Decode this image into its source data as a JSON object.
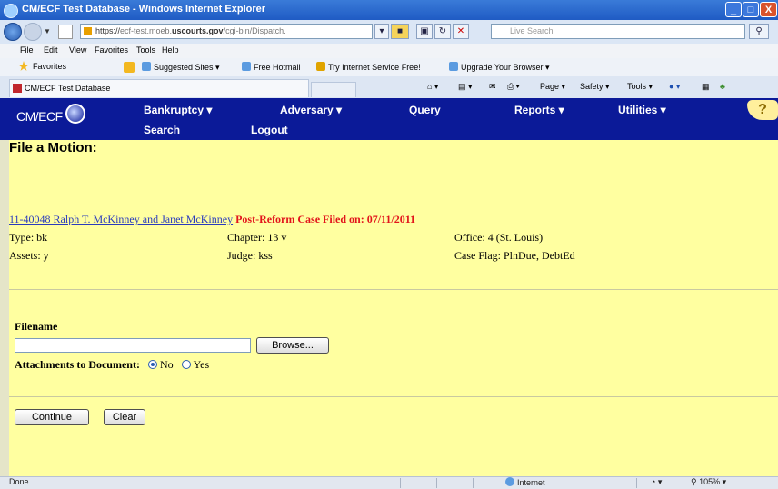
{
  "window": {
    "title": "CM/ECF Test Database - Windows Internet Explorer",
    "controls": {
      "minimize": "_",
      "maximize": "□",
      "close": "X"
    }
  },
  "address_bar": {
    "url_prefix": "https://",
    "url_host": "ecf-test.moeb.",
    "url_domain": "uscourts.gov",
    "url_path": "/cgi-bin/Dispatch.",
    "search_placeholder": "Live Search"
  },
  "menu": [
    "File",
    "Edit",
    "View",
    "Favorites",
    "Tools",
    "Help"
  ],
  "favorites_bar": {
    "favorites_label": "Favorites",
    "links": [
      "Suggested Sites ▾",
      "Free Hotmail",
      "Try Internet Service Free!",
      "Upgrade Your Browser ▾"
    ]
  },
  "tab": {
    "label": "CM/ECF Test Database"
  },
  "command_bar": [
    "Page ▾",
    "Safety ▾",
    "Tools ▾"
  ],
  "ecf_nav": {
    "logo": "CM/ECF",
    "links": [
      "Bankruptcy ▾",
      "Adversary ▾",
      "Query",
      "Reports ▾",
      "Utilities ▾"
    ],
    "links2": [
      "Search",
      "Logout"
    ],
    "help": "?"
  },
  "page": {
    "heading": "File a Motion:",
    "case_link": "11-40048 Ralph T. McKinney and Janet McKinney",
    "case_status": "Post-Reform Case Filed on: 07/11/2011",
    "type": "Type: bk",
    "chapter": "Chapter: 13 v",
    "office": "Office: 4 (St. Louis)",
    "assets": "Assets: y",
    "judge": "Judge: kss",
    "case_flag": "Case Flag: PlnDue, DebtEd",
    "filename_label": "Filename",
    "browse_button": "Browse...",
    "attachments_label": "Attachments to Document:",
    "opt_no": "No",
    "opt_yes": "Yes",
    "continue_button": "Continue",
    "clear_button": "Clear"
  },
  "status_bar": {
    "left": "Done",
    "zone": "Internet",
    "zoom": "105%"
  }
}
